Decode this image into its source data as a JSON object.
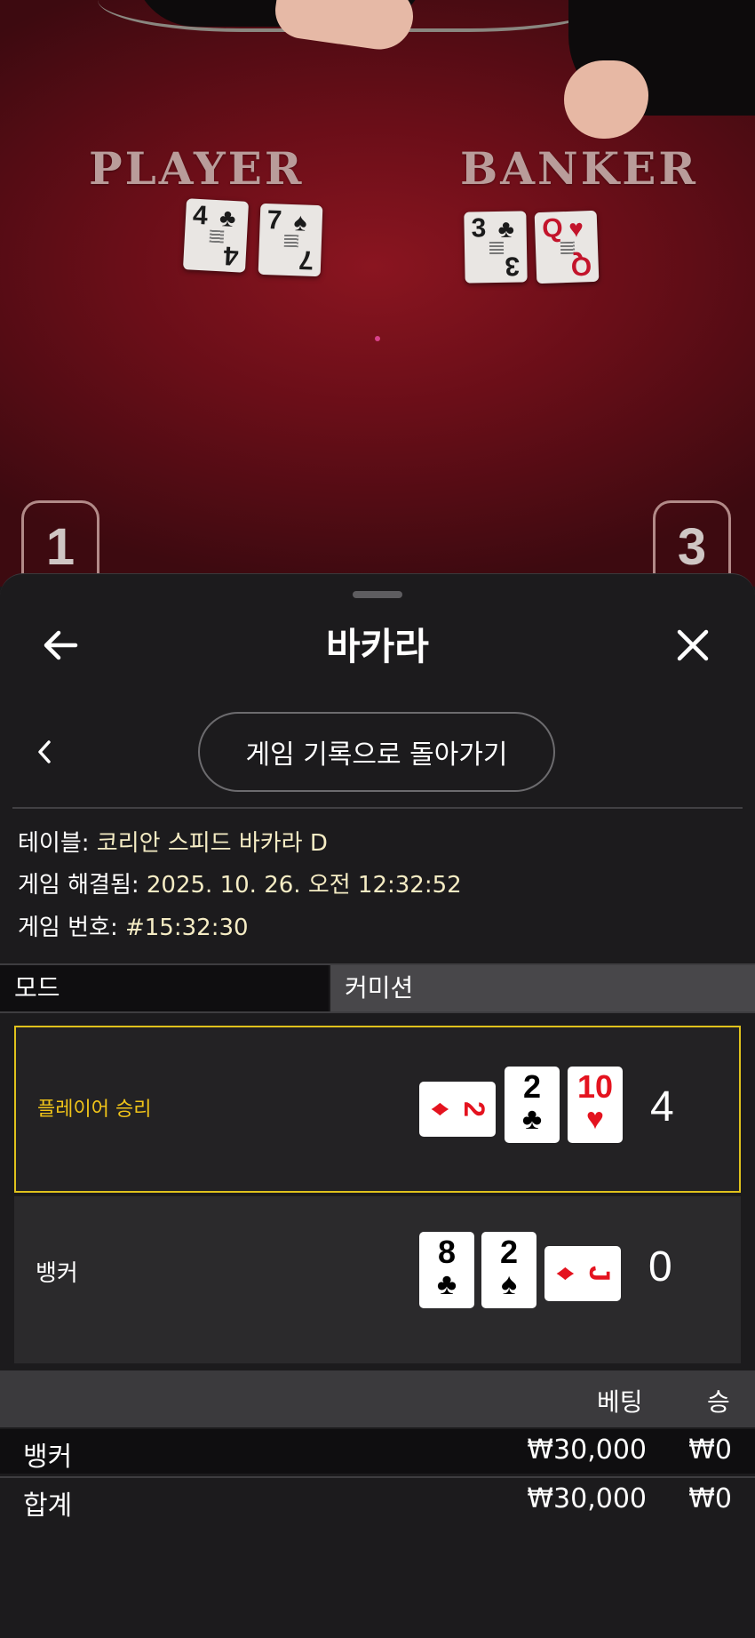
{
  "video": {
    "player_label": "PLAYER",
    "banker_label": "BANKER",
    "player_cards": [
      {
        "rank": "4",
        "suit": "♣",
        "color": "black"
      },
      {
        "rank": "7",
        "suit": "♠",
        "color": "black"
      }
    ],
    "banker_cards": [
      {
        "rank": "3",
        "suit": "♣",
        "color": "black"
      },
      {
        "rank": "Q",
        "suit": "♥",
        "color": "red"
      }
    ],
    "seats": [
      "1",
      "3"
    ]
  },
  "header": {
    "title": "바카라",
    "back_icon": "arrow-left-icon",
    "close_icon": "close-icon"
  },
  "history_button": "게임 기록으로 돌아가기",
  "info": {
    "table_key": "테이블:",
    "table_value": "코리안 스피드 바카라 D",
    "resolved_key": "게임 해결됨:",
    "resolved_value": "2025. 10. 26. 오전 12:32:52",
    "number_key": "게임 번호:",
    "number_value": "#15:32:30"
  },
  "mode": {
    "label": "모드",
    "value": "커미션"
  },
  "results": {
    "player": {
      "label": "플레이어 승리",
      "score": "4",
      "cards": [
        {
          "rank": "2",
          "suit": "♦",
          "color": "red",
          "rotated": true
        },
        {
          "rank": "2",
          "suit": "♣",
          "color": "black",
          "rotated": false
        },
        {
          "rank": "10",
          "suit": "♥",
          "color": "red",
          "rotated": false
        }
      ]
    },
    "banker": {
      "label": "뱅커",
      "score": "0",
      "cards": [
        {
          "rank": "8",
          "suit": "♣",
          "color": "black",
          "rotated": false
        },
        {
          "rank": "2",
          "suit": "♠",
          "color": "black",
          "rotated": false
        },
        {
          "rank": "J",
          "suit": "♦",
          "color": "red",
          "rotated": true
        }
      ]
    }
  },
  "bets": {
    "col_bet": "베팅",
    "col_win": "승",
    "rows": [
      {
        "name": "뱅커",
        "amount": "₩30,000",
        "win": "₩0"
      },
      {
        "name": "합계",
        "amount": "₩30,000",
        "win": "₩0"
      }
    ]
  },
  "colors": {
    "accent_win": "#f0c419",
    "felt": "#7a1019",
    "panel": "#1c1b1d"
  }
}
